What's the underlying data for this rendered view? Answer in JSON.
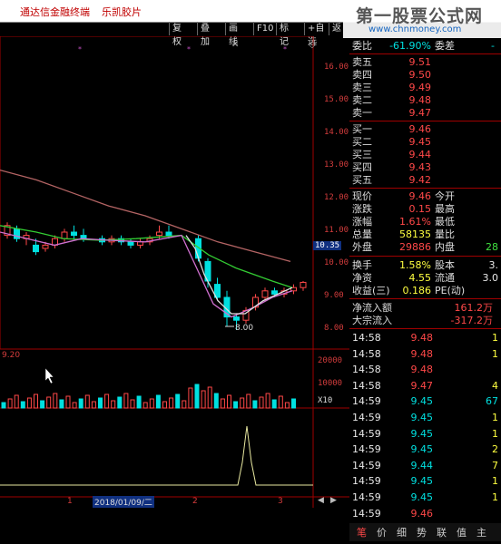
{
  "title": {
    "app": "通达信金融终端",
    "stock": "乐凯胶片"
  },
  "watermark": {
    "line1": "第一股票公式网",
    "line2": "www.chnmoney.com"
  },
  "toolbar": {
    "items": [
      "复权",
      "叠加",
      "画线",
      "F10",
      "标记",
      "+自选",
      "返"
    ]
  },
  "price_axis": {
    "labels": [
      "16.00",
      "15.00",
      "14.00",
      "13.00",
      "12.00",
      "11.00",
      "10.00",
      "9.00",
      "8.00"
    ],
    "current": "10.35"
  },
  "chart": {
    "low_label": "8.00",
    "vol_label": "9.20",
    "vol_axis": [
      "20000",
      "10000",
      "X10"
    ],
    "date": "2018/01/09/二",
    "marks": [
      "1",
      "2",
      "3"
    ]
  },
  "quote": {
    "weibi": {
      "label": "委比",
      "value": "-61.90%",
      "label2": "委差",
      "value2": "-"
    },
    "asks": [
      {
        "label": "卖五",
        "price": "9.51"
      },
      {
        "label": "卖四",
        "price": "9.50"
      },
      {
        "label": "卖三",
        "price": "9.49"
      },
      {
        "label": "卖二",
        "price": "9.48"
      },
      {
        "label": "卖一",
        "price": "9.47"
      }
    ],
    "bids": [
      {
        "label": "买一",
        "price": "9.46"
      },
      {
        "label": "买二",
        "price": "9.45"
      },
      {
        "label": "买三",
        "price": "9.44"
      },
      {
        "label": "买四",
        "price": "9.43"
      },
      {
        "label": "买五",
        "price": "9.42"
      }
    ],
    "stats": [
      {
        "l1": "现价",
        "v1": "9.46",
        "l2": "今开"
      },
      {
        "l1": "涨跌",
        "v1": "0.15",
        "l2": "最高"
      },
      {
        "l1": "涨幅",
        "v1": "1.61%",
        "l2": "最低"
      },
      {
        "l1": "总量",
        "v1": "58135",
        "l2": "量比"
      },
      {
        "l1": "外盘",
        "v1": "29886",
        "l2": "内盘",
        "v2": "28"
      }
    ],
    "stats2": [
      {
        "l1": "换手",
        "v1": "1.58%",
        "l2": "股本",
        "v2": "3."
      },
      {
        "l1": "净资",
        "v1": "4.55",
        "l2": "流通",
        "v2": "3.0"
      },
      {
        "l1": "收益(三)",
        "v1": "0.186",
        "l2": "PE(动)",
        "v2": ""
      }
    ],
    "flows": [
      {
        "label": "净流入额",
        "value": "161.2万"
      },
      {
        "label": "大宗流入",
        "value": "-317.2万"
      }
    ]
  },
  "ticks": [
    {
      "time": "14:58",
      "price": "9.48",
      "vol": "1"
    },
    {
      "time": "14:58",
      "price": "9.48",
      "vol": "1"
    },
    {
      "time": "14:58",
      "price": "9.48",
      "vol": ""
    },
    {
      "time": "14:58",
      "price": "9.47",
      "vol": "4"
    },
    {
      "time": "14:59",
      "price": "9.45",
      "vol": "67"
    },
    {
      "time": "14:59",
      "price": "9.45",
      "vol": "1"
    },
    {
      "time": "14:59",
      "price": "9.45",
      "vol": "1"
    },
    {
      "time": "14:59",
      "price": "9.45",
      "vol": "2"
    },
    {
      "time": "14:59",
      "price": "9.44",
      "vol": "7"
    },
    {
      "time": "14:59",
      "price": "9.45",
      "vol": "1"
    },
    {
      "time": "14:59",
      "price": "9.45",
      "vol": "1"
    },
    {
      "time": "14:59",
      "price": "9.46",
      "vol": ""
    }
  ],
  "tabs": [
    "笔",
    "价",
    "细",
    "势",
    "联",
    "值",
    "主"
  ],
  "colors": {
    "up": "#ff4848",
    "down": "#00e0e0",
    "ma_green": "#33cc33",
    "ma_pink": "#d070d0",
    "ma_white": "#e0e0e0",
    "ma_brown": "#b46464",
    "grid": "#a00000"
  }
}
